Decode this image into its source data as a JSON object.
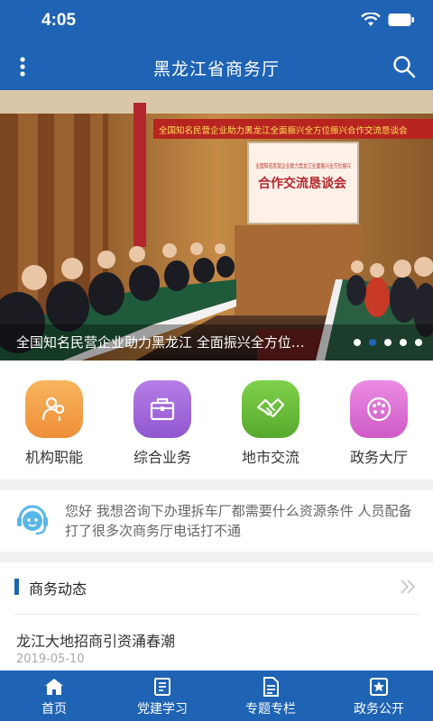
{
  "status": {
    "time": "4:05"
  },
  "nav": {
    "title": "黑龙江省商务厅",
    "menu_icon": "more-vertical-icon",
    "search_icon": "search-icon"
  },
  "banner": {
    "caption": "全国知名民营企业助力黑龙江 全面振兴全方位…",
    "scene_banner": "全国知名民营企业助力黑龙江全面振兴全方位振兴合作交流恳谈会",
    "scene_screen_title": "合作交流恳谈会",
    "scene_screen_text": "全国知名民营企业助力黑龙江全面振兴全方位振兴",
    "slides_total": 5,
    "active_slide": 2
  },
  "quick_actions": [
    {
      "label": "机构职能",
      "icon": "org-person-icon",
      "color": "#f0a04b"
    },
    {
      "label": "综合业务",
      "icon": "briefcase-icon",
      "color": "#a368d8"
    },
    {
      "label": "地市交流",
      "icon": "handshake-icon",
      "color": "#6bbf3a"
    },
    {
      "label": "政务大厅",
      "icon": "hall-dots-icon",
      "color": "#d96fd0"
    }
  ],
  "notice": {
    "icon": "customer-service-icon",
    "text": "您好 我想咨询下办理拆车厂都需要什么资源条件 人员配备 打了很多次商务厅电话打不通"
  },
  "news": {
    "section_title": "商务动态",
    "more_icon": "chevron-double-right-icon",
    "items": [
      {
        "title": "龙江大地招商引资涌春潮",
        "date": "2019-05-10"
      }
    ]
  },
  "tabs": [
    {
      "label": "首页",
      "icon": "home-icon"
    },
    {
      "label": "党建学习",
      "icon": "book-icon"
    },
    {
      "label": "专题专栏",
      "icon": "document-icon"
    },
    {
      "label": "政务公开",
      "icon": "star-board-icon"
    }
  ],
  "colors": {
    "primary": "#1f63b5",
    "active_dot": "#1f63b5"
  }
}
